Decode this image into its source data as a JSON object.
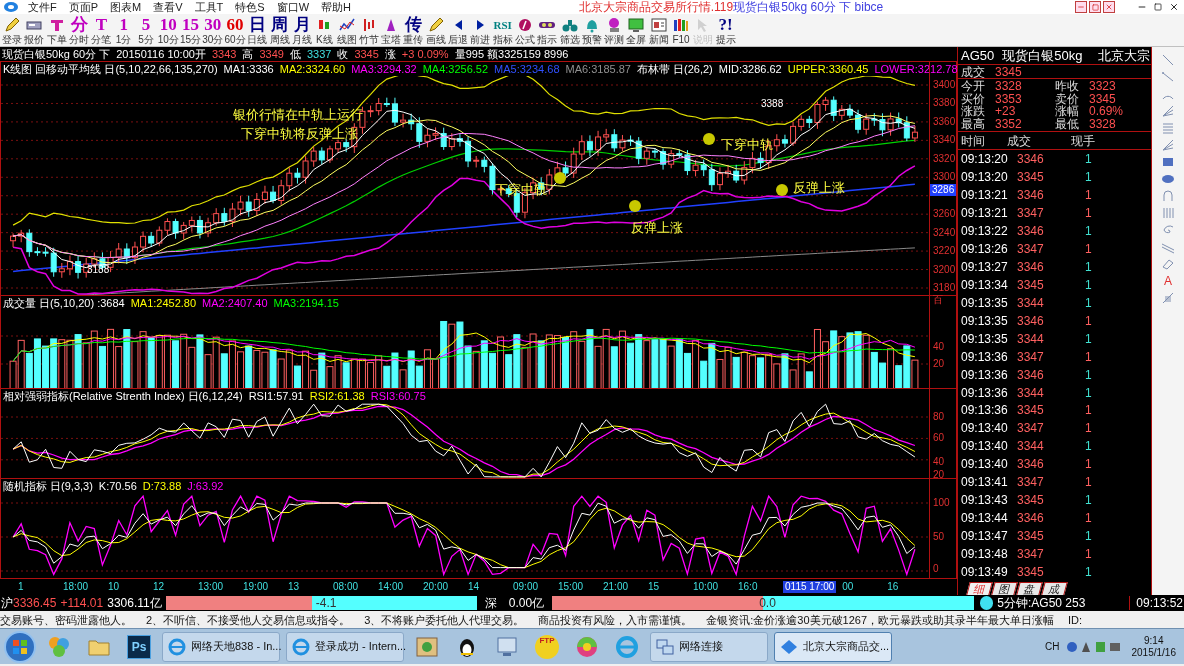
{
  "menu": [
    "文件F",
    "页面P",
    "图表M",
    "查看V",
    "工具T",
    "特色S",
    "窗口W",
    "帮助H"
  ],
  "title": {
    "exchange": "北京大宗商品交易所行情.119",
    "instrument": "现货白银50kg 60分 下 bibce"
  },
  "toolbar": [
    {
      "kind": "pencil",
      "label": "登录",
      "disabled": false
    },
    {
      "kind": "card",
      "label": "报价",
      "disabled": false
    },
    {
      "kind": "order",
      "label": "下单",
      "disabled": false
    },
    {
      "kind": "glyph",
      "glyph": "分",
      "color": "#c000c0",
      "label": "分时",
      "disabled": false
    },
    {
      "kind": "glyph",
      "glyph": "T",
      "color": "#c000c0",
      "label": "分笔",
      "disabled": false
    },
    {
      "kind": "glyph",
      "glyph": "1",
      "color": "#c000c0",
      "label": "1分",
      "disabled": false
    },
    {
      "kind": "glyph",
      "glyph": "5",
      "color": "#c000c0",
      "label": "5分",
      "disabled": false
    },
    {
      "kind": "glyph",
      "glyph": "10",
      "color": "#c000c0",
      "label": "10分",
      "disabled": false
    },
    {
      "kind": "glyph",
      "glyph": "15",
      "color": "#c000c0",
      "label": "15分",
      "disabled": false
    },
    {
      "kind": "glyph",
      "glyph": "30",
      "color": "#c000c0",
      "label": "30分",
      "disabled": false
    },
    {
      "kind": "glyph",
      "glyph": "60",
      "color": "#e00000",
      "label": "60分",
      "disabled": false
    },
    {
      "kind": "glyph",
      "glyph": "日",
      "color": "#000080",
      "label": "日线",
      "disabled": false
    },
    {
      "kind": "glyph",
      "glyph": "周",
      "color": "#000080",
      "label": "周线",
      "disabled": false
    },
    {
      "kind": "glyph",
      "glyph": "月",
      "color": "#000080",
      "label": "月线",
      "disabled": false
    },
    {
      "kind": "candles",
      "label": "K线",
      "disabled": false
    },
    {
      "kind": "linechart",
      "label": "线图",
      "disabled": false
    },
    {
      "kind": "bamboo",
      "label": "竹节",
      "disabled": false
    },
    {
      "kind": "tower",
      "label": "宝塔",
      "disabled": false
    },
    {
      "kind": "glyph",
      "glyph": "传",
      "color": "#000080",
      "label": "重传",
      "disabled": false
    },
    {
      "kind": "pencil",
      "label": "画线",
      "disabled": false
    },
    {
      "kind": "left",
      "label": "后退",
      "disabled": false
    },
    {
      "kind": "right",
      "label": "前进",
      "disabled": false
    },
    {
      "kind": "glyph",
      "glyph": "RSI",
      "color": "#008080",
      "label": "指标",
      "disabled": false
    },
    {
      "kind": "formula",
      "label": "公式",
      "disabled": false
    },
    {
      "kind": "indicator",
      "label": "指示",
      "disabled": false
    },
    {
      "kind": "binoculars",
      "label": "筛选",
      "disabled": false
    },
    {
      "kind": "bell",
      "label": "预警",
      "disabled": false
    },
    {
      "kind": "eval",
      "label": "评测",
      "disabled": false
    },
    {
      "kind": "monitor",
      "label": "全屏",
      "disabled": false
    },
    {
      "kind": "news",
      "label": "新闻",
      "disabled": false
    },
    {
      "kind": "books",
      "label": "F10",
      "disabled": false
    },
    {
      "kind": "help",
      "label": "说明",
      "disabled": true
    },
    {
      "kind": "glyph",
      "glyph": "?!",
      "color": "#000080",
      "label": "提示",
      "disabled": false
    }
  ],
  "quote_line": [
    {
      "text": "现货白银50kg 60分 下"
    },
    {
      "text": "20150116 10:00开"
    },
    {
      "text": "3343",
      "color": "#ff5050"
    },
    {
      "text": "高"
    },
    {
      "text": "3349",
      "color": "#ff5050"
    },
    {
      "text": "低"
    },
    {
      "text": "3337",
      "color": "#40e0e0"
    },
    {
      "text": "收"
    },
    {
      "text": "3345",
      "color": "#ff5050"
    },
    {
      "text": "涨"
    },
    {
      "text": "+3 0.09%",
      "color": "#ff5050"
    },
    {
      "text": "量995 额3325159 8996"
    }
  ],
  "main_chart": {
    "legend": [
      {
        "text": "K线图 回移动平均线 日(5,10,22,66,135,270)"
      },
      {
        "text": "MA1:3336"
      },
      {
        "text": "MA2:3324.60",
        "color": "#ffff00"
      },
      {
        "text": "MA3:3294.32",
        "color": "#ff00ff"
      },
      {
        "text": "MA4:3256.52",
        "color": "#00ff00"
      },
      {
        "text": "MA5:3234.68",
        "color": "#3050ff"
      },
      {
        "text": "MA6:3185.87",
        "color": "#909090"
      },
      {
        "text": "布林带 日(26,2)"
      },
      {
        "text": "MID:3286.62"
      },
      {
        "text": "UPPER:3360.45",
        "color": "#ffff00"
      },
      {
        "text": "LOWER:3212.78",
        "color": "#ff00ff"
      }
    ],
    "yticks": [
      "3400",
      "3380",
      "3360",
      "3340",
      "3320",
      "3300",
      "3260",
      "3240",
      "3220",
      "3200",
      "3180"
    ],
    "price_tag": "3286",
    "annotations": [
      {
        "kind": "note",
        "text": "银价行情在中轨上运行"
      },
      {
        "kind": "note",
        "text": "下穿中轨将反弹上涨"
      },
      {
        "kind": "label",
        "text": "下穿中轨"
      },
      {
        "kind": "label",
        "text": "反弹上涨"
      },
      {
        "kind": "label",
        "text": "下穿中轨"
      },
      {
        "kind": "label",
        "text": "反弹上涨"
      },
      {
        "kind": "price",
        "text": "3388"
      },
      {
        "kind": "price",
        "text": "3188"
      }
    ]
  },
  "volume_chart": {
    "legend": [
      {
        "text": "成交量 日(5,10,20) :3684"
      },
      {
        "text": "MA1:2452.80",
        "color": "#ffff00"
      },
      {
        "text": "MA2:2407.40",
        "color": "#ff00ff"
      },
      {
        "text": "MA3:2194.15",
        "color": "#00ff00"
      }
    ],
    "yticks": [
      "百",
      "40",
      "20"
    ]
  },
  "rsi_chart": {
    "legend": [
      {
        "text": "相对强弱指标(Relative Strenth Index) 日(6,12,24)"
      },
      {
        "text": "RSI1:57.91"
      },
      {
        "text": "RSI2:61.38",
        "color": "#ffff00"
      },
      {
        "text": "RSI3:60.75",
        "color": "#ff00ff"
      }
    ],
    "yticks": [
      "80",
      "60",
      "40",
      "20"
    ]
  },
  "kdj_chart": {
    "legend": [
      {
        "text": "随机指标 日(9,3,3)"
      },
      {
        "text": "K:70.56"
      },
      {
        "text": "D:73.88",
        "color": "#ffff00"
      },
      {
        "text": "J:63.92",
        "color": "#ff00ff"
      }
    ],
    "yticks": [
      "100",
      "50",
      "0"
    ]
  },
  "time_axis": [
    {
      "kind": "tick",
      "text": "1"
    },
    {
      "kind": "tick",
      "text": "18:00"
    },
    {
      "kind": "tick",
      "text": "10"
    },
    {
      "kind": "tick",
      "text": "12"
    },
    {
      "kind": "tick",
      "text": "13:00"
    },
    {
      "kind": "tick",
      "text": "19:00"
    },
    {
      "kind": "tick",
      "text": "13"
    },
    {
      "kind": "tick",
      "text": "08:00"
    },
    {
      "kind": "tick",
      "text": "14:00"
    },
    {
      "kind": "tick",
      "text": "20:00"
    },
    {
      "kind": "tick",
      "text": "14"
    },
    {
      "kind": "tick",
      "text": "09:00"
    },
    {
      "kind": "tick",
      "text": "15:00"
    },
    {
      "kind": "tick",
      "text": "21:00"
    },
    {
      "kind": "tick",
      "text": "15"
    },
    {
      "kind": "tick",
      "text": "10:00"
    },
    {
      "kind": "tick",
      "text": "16:0"
    },
    {
      "kind": "cursor",
      "text": "0115 17:00"
    },
    {
      "kind": "tick",
      "text": "00"
    },
    {
      "kind": "tick",
      "text": "16"
    }
  ],
  "quote_panel": {
    "code": "AG50",
    "name": "现货白银50kg",
    "exchange": "北京大宗",
    "last_label": "成交",
    "last": "3345",
    "fields": [
      {
        "label": "今开",
        "value": "3328"
      },
      {
        "label": "昨收",
        "value": "3323"
      },
      {
        "label": "买价",
        "value": "3353"
      },
      {
        "label": "卖价",
        "value": "3345"
      },
      {
        "label": "涨跌",
        "value": "+23"
      },
      {
        "label": "涨幅",
        "value": "0.69%"
      },
      {
        "label": "最高",
        "value": "3352"
      },
      {
        "label": "最低",
        "value": "3328"
      }
    ],
    "columns": [
      "时间",
      "成交",
      "现手"
    ],
    "trades": [
      {
        "time": "09:13:20",
        "price": "3346",
        "qty": "1",
        "color": "#40e0d0"
      },
      {
        "time": "09:13:20",
        "price": "3345",
        "qty": "1",
        "color": "#40e0d0"
      },
      {
        "time": "09:13:21",
        "price": "3346",
        "qty": "1",
        "color": "#ff6060"
      },
      {
        "time": "09:13:21",
        "price": "3347",
        "qty": "1",
        "color": "#ff6060"
      },
      {
        "time": "09:13:22",
        "price": "3346",
        "qty": "1",
        "color": "#40e0d0"
      },
      {
        "time": "09:13:26",
        "price": "3347",
        "qty": "1",
        "color": "#ff6060"
      },
      {
        "time": "09:13:27",
        "price": "3346",
        "qty": "1",
        "color": "#40e0d0"
      },
      {
        "time": "09:13:34",
        "price": "3345",
        "qty": "1",
        "color": "#40e0d0"
      },
      {
        "time": "09:13:35",
        "price": "3344",
        "qty": "1",
        "color": "#40e0d0"
      },
      {
        "time": "09:13:35",
        "price": "3346",
        "qty": "1",
        "color": "#ff6060"
      },
      {
        "time": "09:13:35",
        "price": "3344",
        "qty": "1",
        "color": "#40e0d0"
      },
      {
        "time": "09:13:36",
        "price": "3347",
        "qty": "1",
        "color": "#ff6060"
      },
      {
        "time": "09:13:36",
        "price": "3346",
        "qty": "1",
        "color": "#40e0d0"
      },
      {
        "time": "09:13:36",
        "price": "3344",
        "qty": "1",
        "color": "#40e0d0"
      },
      {
        "time": "09:13:36",
        "price": "3345",
        "qty": "1",
        "color": "#ff6060"
      },
      {
        "time": "09:13:40",
        "price": "3347",
        "qty": "1",
        "color": "#ff6060"
      },
      {
        "time": "09:13:40",
        "price": "3344",
        "qty": "1",
        "color": "#40e0d0"
      },
      {
        "time": "09:13:40",
        "price": "3346",
        "qty": "1",
        "color": "#ff6060"
      },
      {
        "time": "09:13:41",
        "price": "3347",
        "qty": "1",
        "color": "#ff6060"
      },
      {
        "time": "09:13:43",
        "price": "3345",
        "qty": "1",
        "color": "#40e0d0"
      },
      {
        "time": "09:13:44",
        "price": "3346",
        "qty": "1",
        "color": "#ff6060"
      },
      {
        "time": "09:13:47",
        "price": "3345",
        "qty": "1",
        "color": "#40e0d0"
      },
      {
        "time": "09:13:48",
        "price": "3347",
        "qty": "1",
        "color": "#ff6060"
      },
      {
        "time": "09:13:49",
        "price": "3345",
        "qty": "1",
        "color": "#40e0d0"
      }
    ],
    "tabs": [
      {
        "label": "细",
        "selected": true
      },
      {
        "label": "图",
        "selected": false
      },
      {
        "label": "盘",
        "selected": false
      },
      {
        "label": "成",
        "selected": false
      }
    ]
  },
  "draw_tools": [
    {
      "kind": "line"
    },
    {
      "kind": "ray"
    },
    {
      "kind": "arc"
    },
    {
      "kind": "fan"
    },
    {
      "kind": "lines"
    },
    {
      "kind": "fan"
    },
    {
      "kind": "rect"
    },
    {
      "kind": "ellipse"
    },
    {
      "kind": "arch"
    },
    {
      "kind": "bars"
    },
    {
      "kind": "spiral"
    },
    {
      "kind": "channel"
    },
    {
      "kind": "eraser"
    },
    {
      "kind": "text",
      "glyph": "A"
    },
    {
      "kind": "ruler"
    }
  ],
  "status_bar": {
    "sh_label": "沪",
    "sh_index": "3336.45",
    "sh_change": "+114.01",
    "sh_amount": "3306.11亿",
    "sh_bar": {
      "text": "-4.1",
      "level": 0.47
    },
    "sz_label": "深",
    "sz_amount": "0.00亿",
    "sz_bar": {
      "text": "0.0",
      "level": 0.5
    },
    "feed": "5分钟:AG50 253",
    "clock": "09:13:52"
  },
  "ticker": [
    "交易账号、密码泄露他人。",
    "2、不听信、不接受他人交易信息或指令。",
    "3、不将账户委托他人代理交易。",
    "商品投资有风险，入市需谨慎。",
    "金银资讯:金价涨逾30美元破1267，欧元暴跌或助其录半年最大单日涨幅",
    "ID:"
  ],
  "taskbar": {
    "items": [
      {
        "kind": "media"
      },
      {
        "kind": "folder"
      },
      {
        "kind": "ps",
        "glyph": "Ps"
      },
      {
        "kind": "webpage",
        "label": "网络天地838 - In...",
        "selected": false
      },
      {
        "kind": "webpage",
        "label": "登录成功 - Intern...",
        "selected": false
      },
      {
        "kind": "picture"
      },
      {
        "kind": "penguin"
      },
      {
        "kind": "monitor"
      },
      {
        "kind": "ftp",
        "glyph": "FTP"
      },
      {
        "kind": "ball"
      },
      {
        "kind": "browser"
      },
      {
        "kind": "network",
        "label": "网络连接",
        "selected": false
      },
      {
        "kind": "window",
        "label": "北京大宗商品交...",
        "selected": true
      }
    ],
    "language": "CH",
    "time": "9:14",
    "date": "2015/1/16"
  }
}
